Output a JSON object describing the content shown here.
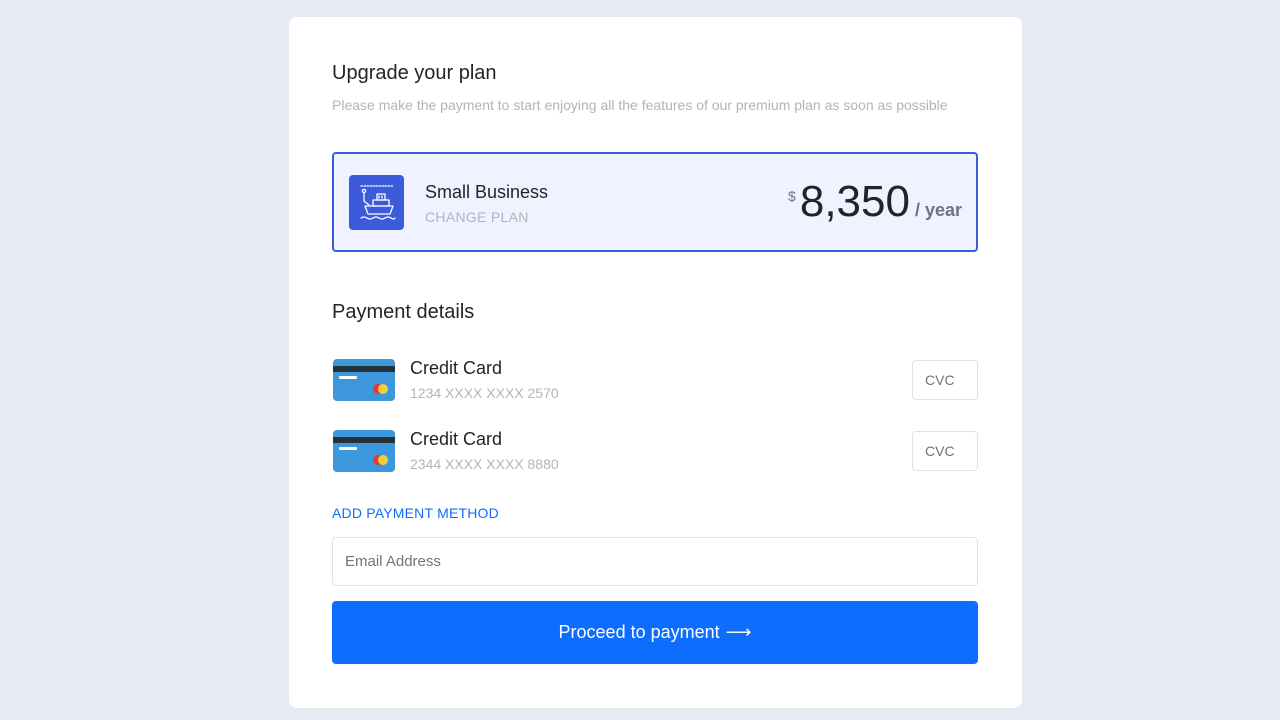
{
  "header": {
    "title": "Upgrade your plan",
    "subtitle": "Please make the payment to start enjoying all the features of our premium plan as soon as possible"
  },
  "plan": {
    "icon": "ship-icon",
    "name": "Small Business",
    "change_label": "CHANGE PLAN",
    "currency": "$",
    "amount": "8,350",
    "period": "/ year"
  },
  "payment": {
    "section_title": "Payment details",
    "methods": [
      {
        "icon": "credit-card-icon",
        "title": "Credit Card",
        "number": "1234 XXXX XXXX 2570",
        "cvc_placeholder": "CVC"
      },
      {
        "icon": "credit-card-icon",
        "title": "Credit Card",
        "number": "2344 XXXX XXXX 8880",
        "cvc_placeholder": "CVC"
      }
    ],
    "add_label": "ADD PAYMENT METHOD"
  },
  "email": {
    "placeholder": "Email Address",
    "value": ""
  },
  "proceed": {
    "label": "Proceed to payment",
    "arrow": "⟶"
  },
  "colors": {
    "background": "#e6eaf2",
    "accent": "#0d6efd",
    "plan_accent": "#3b5bdb",
    "card_blue": "#3d97dd"
  }
}
